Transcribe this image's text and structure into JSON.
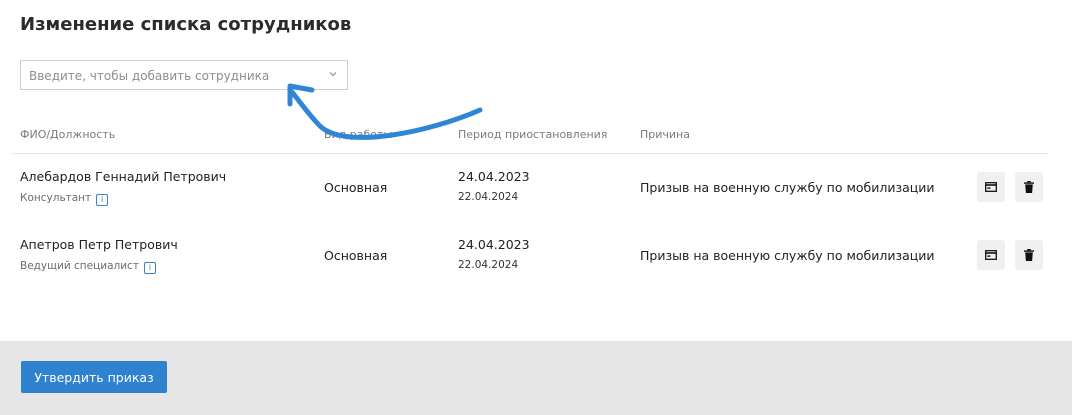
{
  "page": {
    "title": "Изменение списка сотрудников",
    "search_placeholder": "Введите, чтобы добавить сотрудника"
  },
  "table": {
    "headers": [
      "ФИО/Должность",
      "Вид работы",
      "Период приостановления",
      "Причина"
    ],
    "rows": [
      {
        "name": "Алебардов Геннадий Петрович",
        "position": "Консультант",
        "work_type": "Основная",
        "period_start": "24.04.2023",
        "period_end": "22.04.2024",
        "reason": "Призыв на военную службу по мобилизации"
      },
      {
        "name": "Апетров Петр Петрович",
        "position": "Ведущий специалист",
        "work_type": "Основная",
        "period_start": "24.04.2023",
        "period_end": "22.04.2024",
        "reason": "Призыв на военную службу по мобилизации"
      }
    ]
  },
  "footer": {
    "approve_label": "Утвердить приказ"
  },
  "icons": {
    "info": "i"
  },
  "colors": {
    "accent": "#2f82cf",
    "arrow": "#2f86d6"
  }
}
